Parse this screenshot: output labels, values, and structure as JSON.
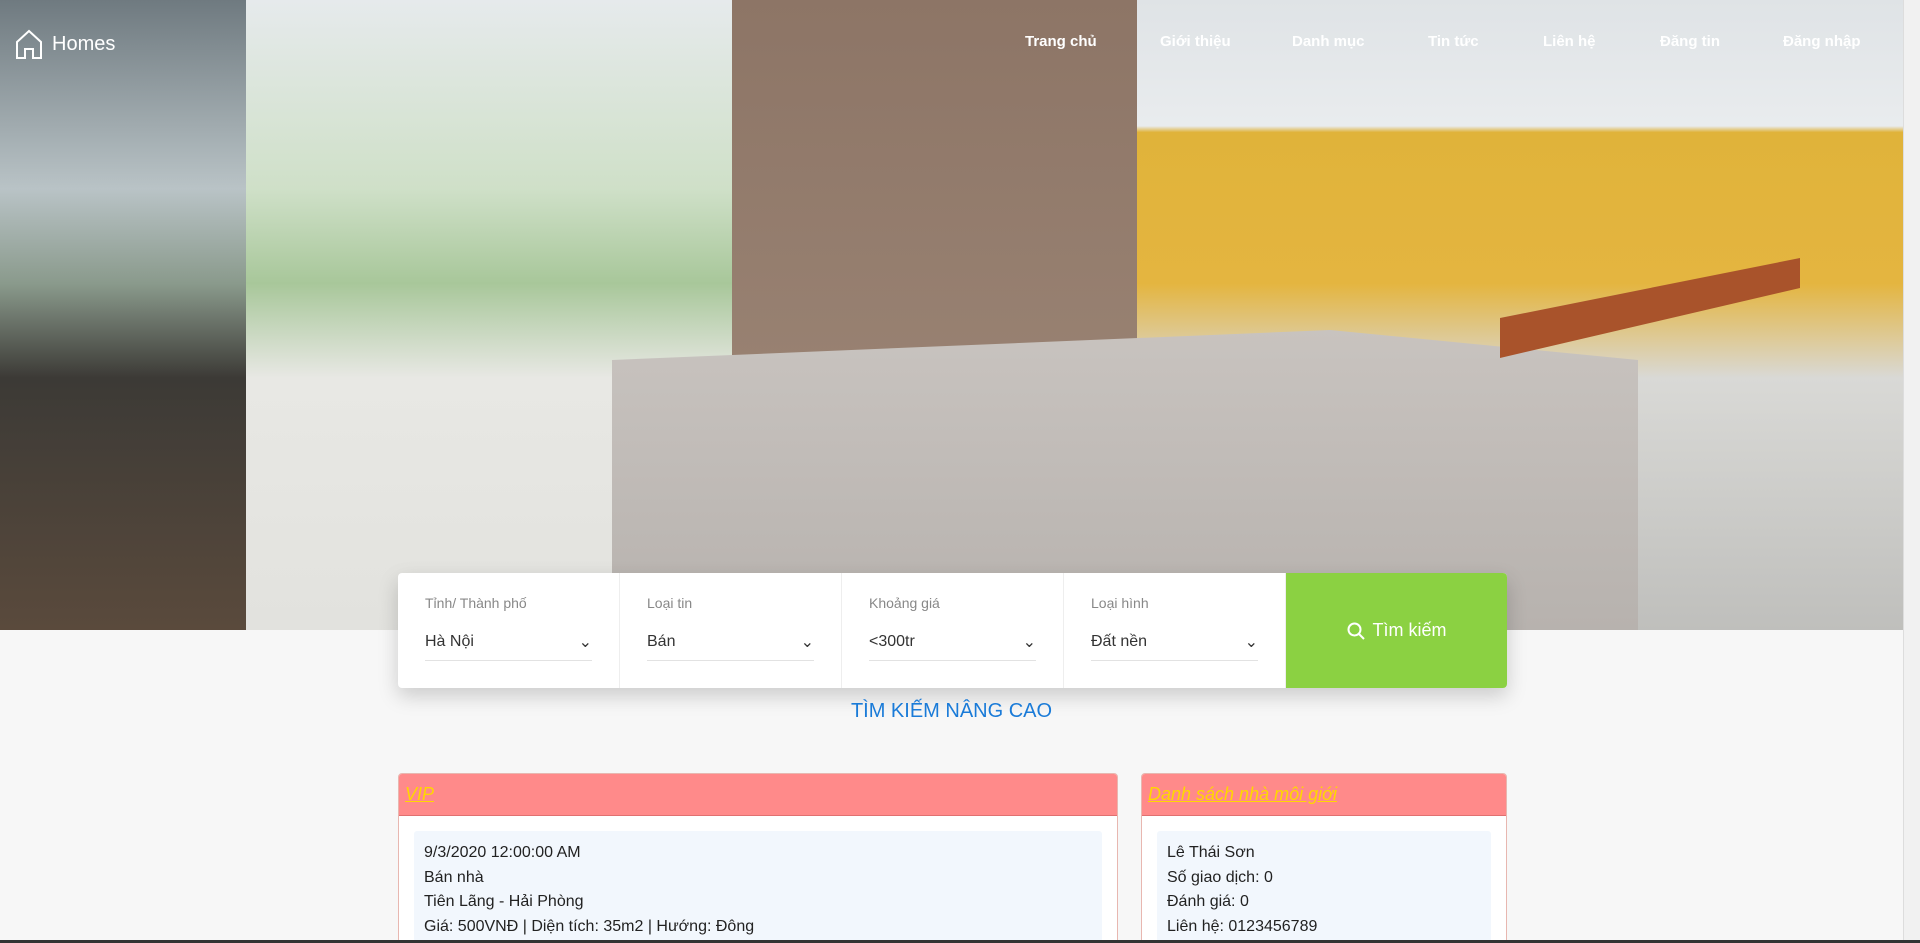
{
  "header": {
    "brand": "Homes",
    "nav": [
      "Trang chủ",
      "Giới thiệu",
      "Danh mục",
      "Tin tức",
      "Liên hệ",
      "Đăng tin",
      "Đăng nhập"
    ]
  },
  "search": {
    "fields": [
      {
        "label": "Tỉnh/ Thành phố",
        "value": "Hà Nội"
      },
      {
        "label": "Loại tin",
        "value": "Bán"
      },
      {
        "label": "Khoảng giá",
        "value": "<300tr"
      },
      {
        "label": "Loại hình",
        "value": "Đất nền"
      }
    ],
    "button": "Tìm kiếm",
    "advanced": "TÌM KIẾM NÂNG CAO"
  },
  "vip": {
    "title": "VIP",
    "item": {
      "date": "9/3/2020 12:00:00 AM",
      "type": "Bán nhà",
      "location": "Tiên Lãng - Hải Phòng",
      "details": "Giá: 500VNĐ | Diện tích: 35m2 | Hướng: Đông"
    }
  },
  "brokers": {
    "title": "Danh sách nhà môi giới",
    "item": {
      "name": "Lê Thái Sơn",
      "deals": "Số giao dịch: 0",
      "rating": "Đánh giá: 0",
      "contact": "Liên hệ: 0123456789"
    }
  },
  "colors": {
    "search_button": "#8bd142",
    "panel_header": "#ff8a8a",
    "panel_title": "#ffd700",
    "advanced_link": "#1a7bd8"
  }
}
